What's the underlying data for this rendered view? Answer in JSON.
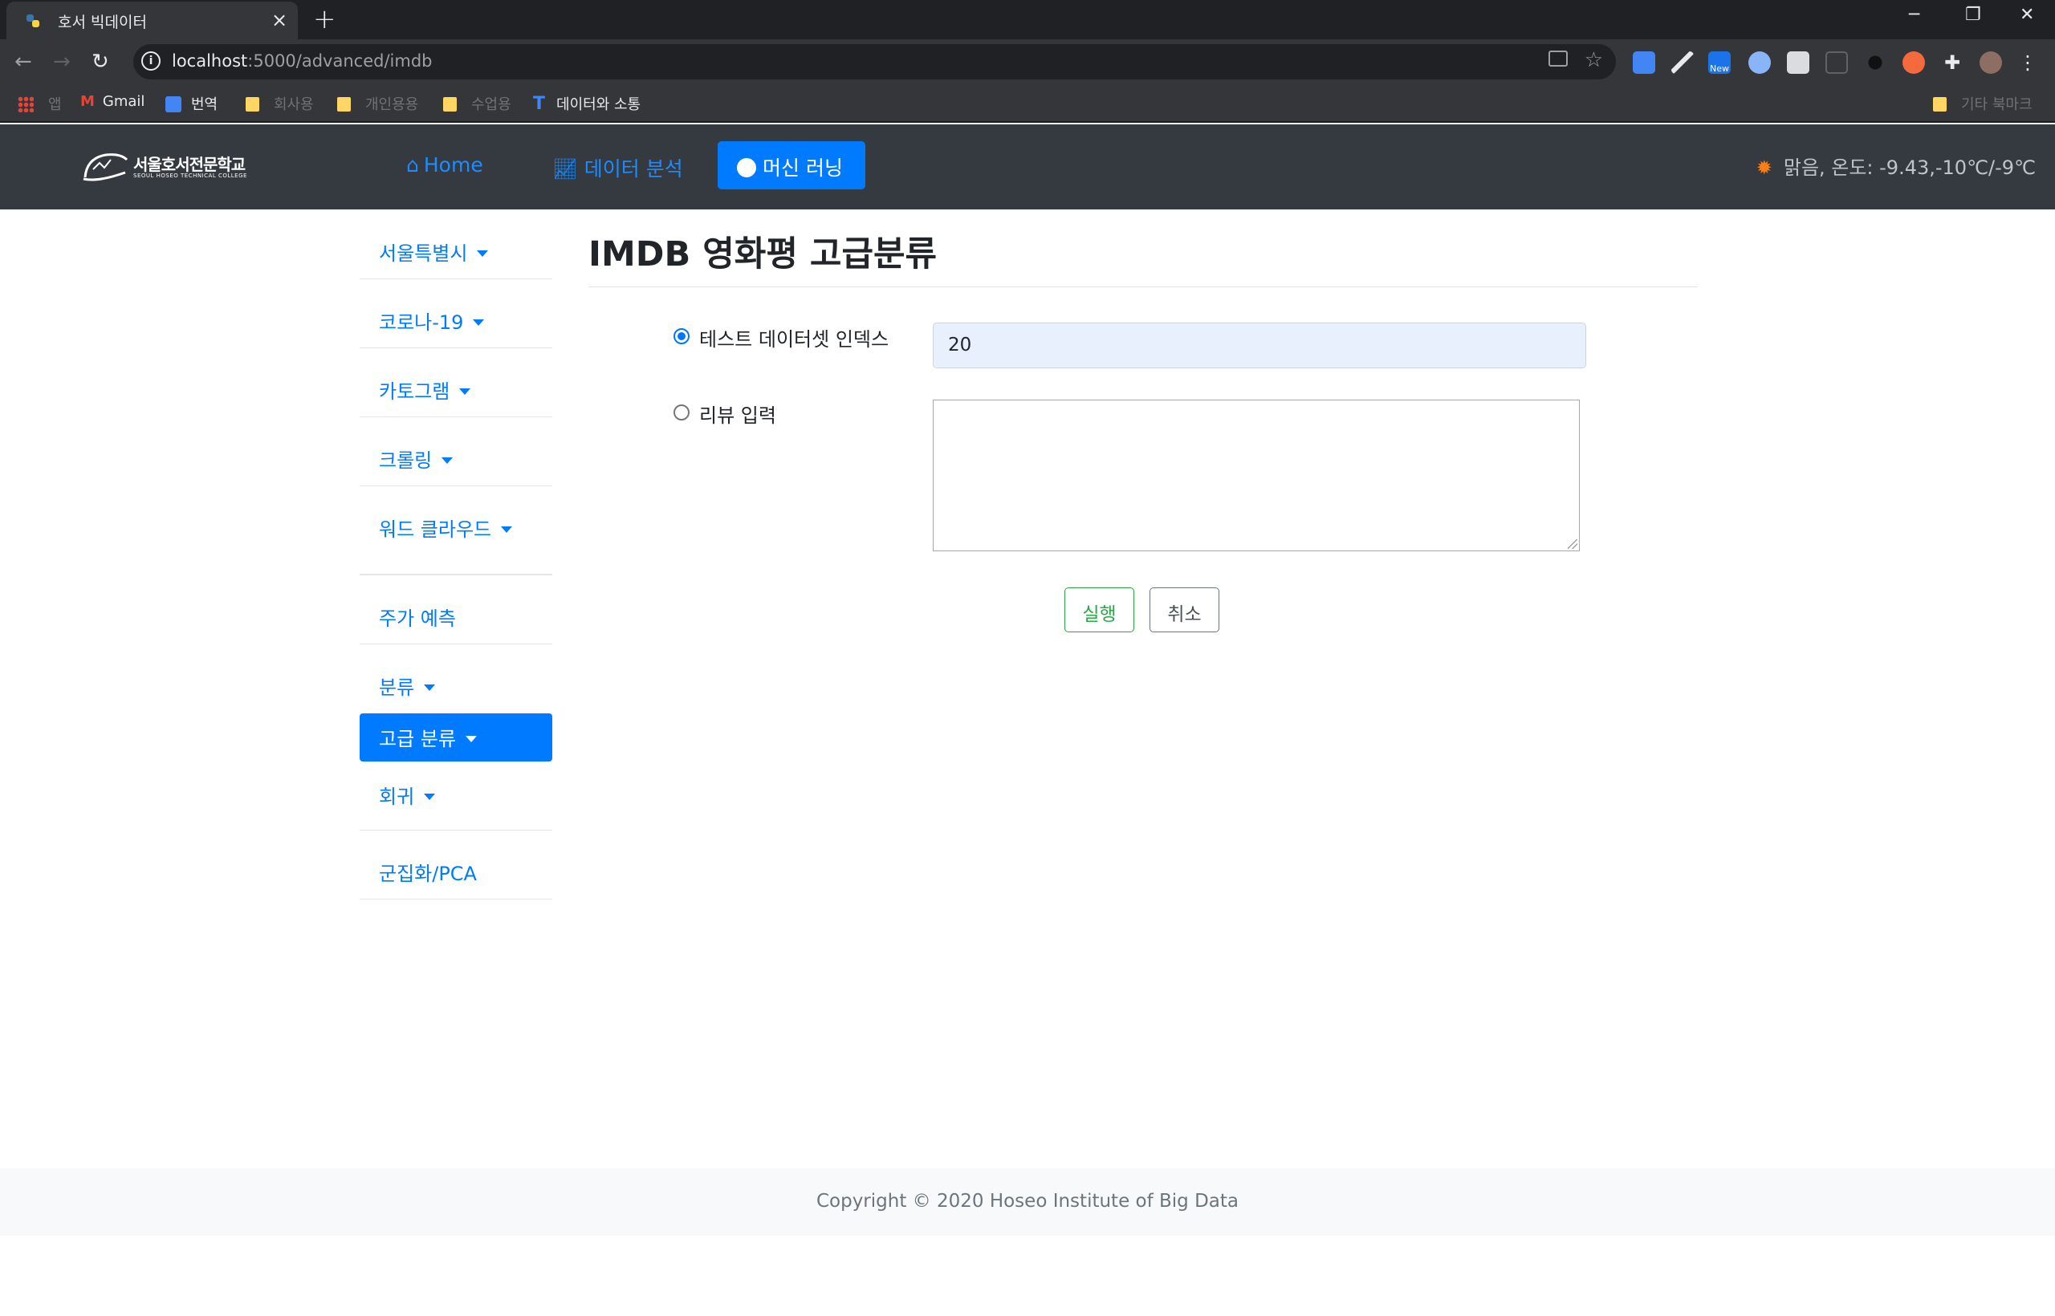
{
  "browser": {
    "tab_title": "호서 빅데이터",
    "tab_close": "×",
    "new_tab": "+",
    "url_host": "localhost",
    "url_path": ":5000/advanced/imdb",
    "window_controls": [
      "─",
      "❐",
      "✕"
    ],
    "bookmarks": [
      {
        "label": "앱",
        "dim": true
      },
      {
        "label": "Gmail",
        "dim": false
      },
      {
        "label": "번역",
        "dim": false
      },
      {
        "label": "회사용",
        "dim": true
      },
      {
        "label": "개인용용",
        "dim": true
      },
      {
        "label": "수업용",
        "dim": true
      },
      {
        "label": "데이터와 소통",
        "dim": false
      }
    ],
    "other_bookmarks": "기타 북마크",
    "ext_new_badge": "New"
  },
  "nav": {
    "logo_text": "서울호서전문학교",
    "logo_sub": "SEOUL HOSEO TECHNICAL COLLEGE",
    "home": "Home",
    "data_analysis": "데이터 분석",
    "machine_learning": "머신 러닝",
    "weather": "맑음, 온도: -9.43,-10℃/-9℃"
  },
  "sidebar": {
    "items": [
      {
        "label": "서울특별시",
        "caret": true
      },
      {
        "label": "코로나-19",
        "caret": true
      },
      {
        "label": "카토그램",
        "caret": true
      },
      {
        "label": "크롤링",
        "caret": true
      },
      {
        "label": "워드 클라우드",
        "caret": true
      },
      {
        "label": "주가 예측",
        "caret": false
      },
      {
        "label": "분류",
        "caret": true
      },
      {
        "label": "고급 분류",
        "caret": true,
        "active": true
      },
      {
        "label": "회귀",
        "caret": true
      },
      {
        "label": "군집화/PCA",
        "caret": false
      }
    ]
  },
  "main": {
    "title": "IMDB 영화평 고급분류",
    "option_index_label": "테스트 데이터셋 인덱스",
    "option_index_value": "20",
    "option_review_label": "리뷰 입력",
    "review_value": "",
    "run_button": "실행",
    "cancel_button": "취소"
  },
  "footer": {
    "copyright": "Copyright © 2020 Hoseo Institute of Big Data"
  },
  "colors": {
    "primary": "#007bff",
    "navbar": "#343a40",
    "success": "#28a745",
    "secondary": "#6c757d"
  }
}
